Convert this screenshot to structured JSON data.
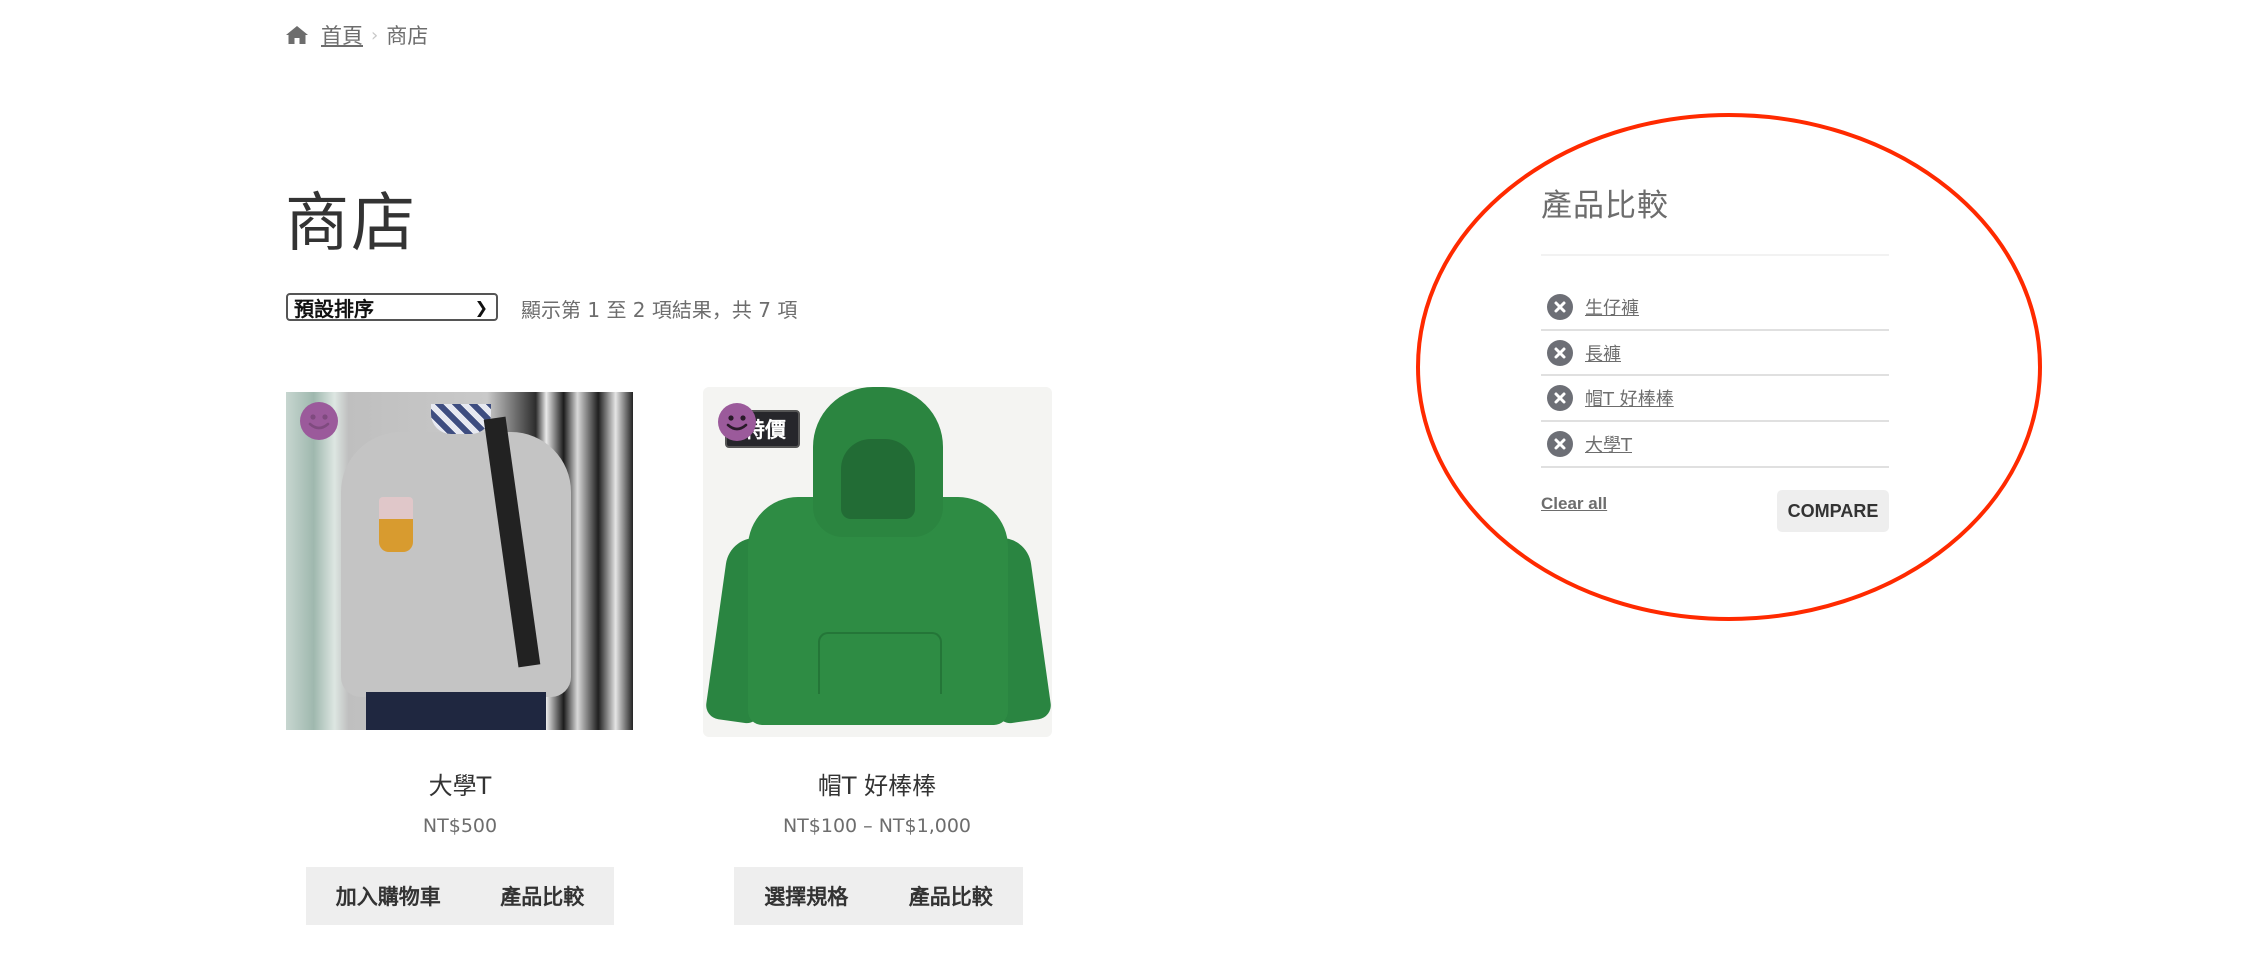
{
  "breadcrumb": {
    "home_icon": "home-icon",
    "home_label": "首頁",
    "separator": "›",
    "current": "商店"
  },
  "page": {
    "title": "商店"
  },
  "toolbar": {
    "sort_selected": "預設排序",
    "result_count": "顯示第 1 至 2 項結果，共 7 項"
  },
  "products": [
    {
      "name": "大學T",
      "price": "NT$500",
      "badge": null,
      "primary_action": "加入購物車",
      "compare_action": "產品比較",
      "image_icon": "smiley-icon"
    },
    {
      "name": "帽T 好棒棒",
      "price": "NT$100 – NT$1,000",
      "badge": "特價",
      "primary_action": "選擇規格",
      "compare_action": "產品比較",
      "image_icon": "smiley-icon"
    }
  ],
  "compare_widget": {
    "title": "產品比較",
    "items": [
      {
        "label": "生仔褲",
        "remove_icon": "remove-circle-icon"
      },
      {
        "label": "長褲",
        "remove_icon": "remove-circle-icon"
      },
      {
        "label": "帽T 好棒棒",
        "remove_icon": "remove-circle-icon"
      },
      {
        "label": "大學T",
        "remove_icon": "remove-circle-icon"
      }
    ],
    "clear_all_label": "Clear all",
    "compare_label": "COMPARE"
  },
  "colors": {
    "annotation_ellipse": "#ff2a00",
    "smiley": "#9b5a9b",
    "button_bg": "#eeeeee",
    "text_muted": "#6d6d6d"
  }
}
